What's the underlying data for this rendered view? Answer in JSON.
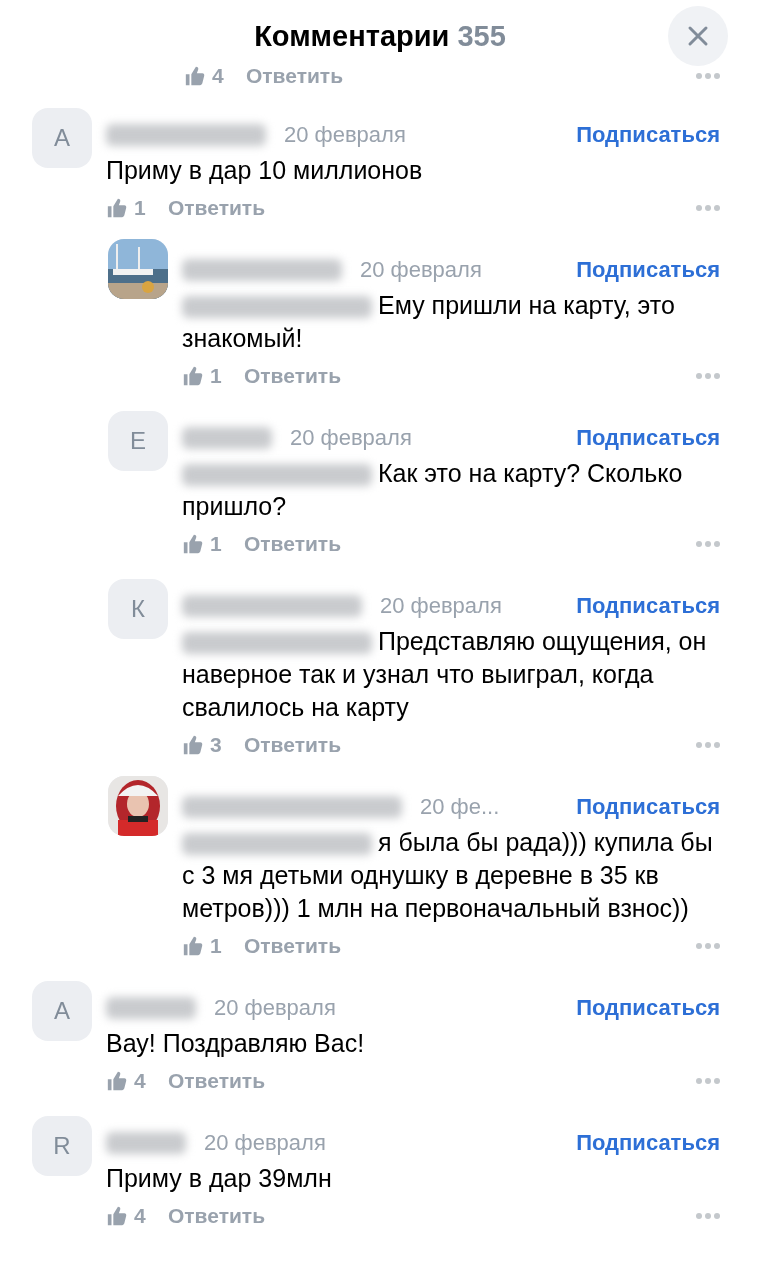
{
  "header": {
    "title": "Комментарии",
    "count": "355"
  },
  "partial_actions": {
    "likes": "4",
    "reply": "Ответить"
  },
  "comments": [
    {
      "avatar": {
        "kind": "letter",
        "letter": "А"
      },
      "date": "20 февраля",
      "subscribe": "Подписаться",
      "mention": false,
      "text": "Приму в дар 10 миллионов",
      "likes": "1",
      "reply": "Ответить",
      "children": [
        {
          "date": "20 февраля",
          "subscribe": "Подписаться",
          "mention": true,
          "text": "Ему пришли на карту, это знакомый!",
          "likes": "1",
          "reply": "Ответить"
        },
        {
          "avatar": {
            "kind": "letter",
            "letter": "Е"
          },
          "date": "20 февраля",
          "subscribe": "Подписаться",
          "mention": true,
          "text": "Как это на карту? Сколько пришло?",
          "likes": "1",
          "reply": "Ответить"
        },
        {
          "avatar": {
            "kind": "letter",
            "letter": "К"
          },
          "date": "20 февраля",
          "subscribe": "Подписаться",
          "mention": true,
          "text": "Представляю ощущения, он наверное так и узнал что выиграл, когда свалилось на карту",
          "likes": "3",
          "reply": "Ответить"
        },
        {
          "date": "20 фе...",
          "subscribe": "Подписаться",
          "mention": true,
          "text": "я была бы рада))) купила бы с 3 мя детьми однушку в деревне в 35 кв метров))) 1 млн  на первоначальный взнос))",
          "likes": "1",
          "reply": "Ответить"
        }
      ]
    },
    {
      "avatar": {
        "kind": "letter",
        "letter": "А"
      },
      "date": "20 февраля",
      "subscribe": "Подписаться",
      "mention": false,
      "text": "Вау! Поздравляю Вас!",
      "likes": "4",
      "reply": "Ответить"
    },
    {
      "avatar": {
        "kind": "letter",
        "letter": "R"
      },
      "date": "20 февраля",
      "subscribe": "Подписаться",
      "mention": false,
      "text": "Приму в дар 39млн",
      "likes": "4",
      "reply": "Ответить"
    }
  ]
}
